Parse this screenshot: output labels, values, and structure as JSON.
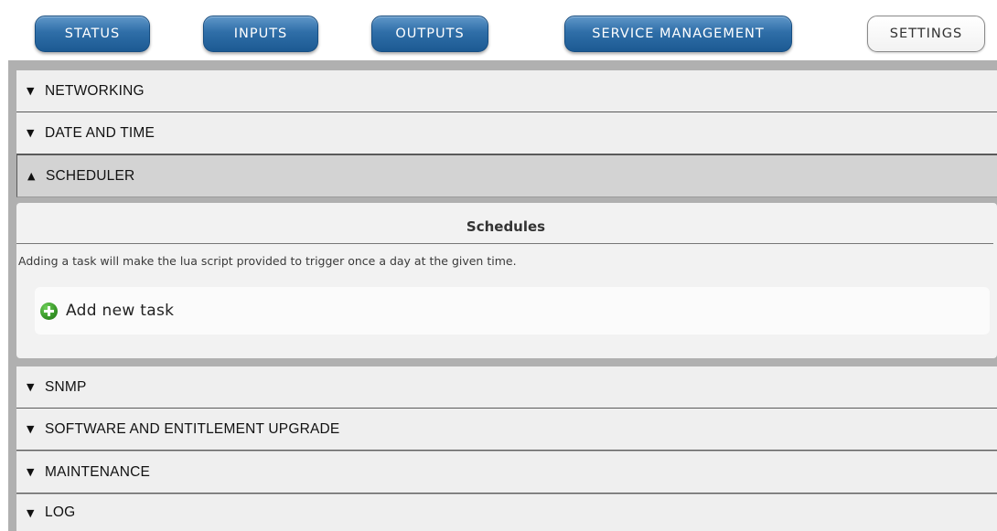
{
  "nav": {
    "status": "STATUS",
    "inputs": "INPUTS",
    "outputs": "OUTPUTS",
    "service_management": "SERVICE MANAGEMENT",
    "settings": "SETTINGS"
  },
  "sections": {
    "networking": "NETWORKING",
    "date_time": "DATE AND TIME",
    "scheduler": "SCHEDULER",
    "snmp": "SNMP",
    "software_upgrade": "SOFTWARE AND ENTITLEMENT UPGRADE",
    "maintenance": "MAINTENANCE",
    "log": "LOG"
  },
  "icons": {
    "collapsed": "▼",
    "expanded": "▲"
  },
  "scheduler": {
    "title": "Schedules",
    "description": "Adding a task will make the lua script provided to trigger once a day at the given time.",
    "add_task_label": "Add new task"
  },
  "colors": {
    "nav_blue": "#2f6ea8",
    "add_icon_green": "#3a9a2a",
    "open_section_bg": "#d3d3d3"
  }
}
